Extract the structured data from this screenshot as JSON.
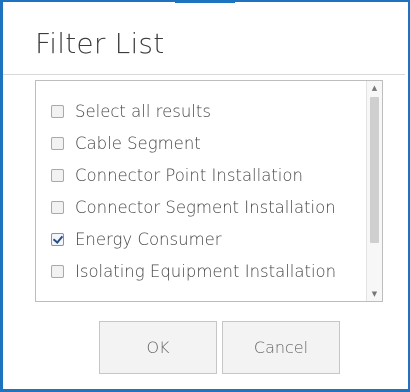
{
  "dialog": {
    "title": "Filter List",
    "items": [
      {
        "label": "Select all results",
        "checked": false
      },
      {
        "label": "Cable Segment",
        "checked": false
      },
      {
        "label": "Connector Point Installation",
        "checked": false
      },
      {
        "label": "Connector Segment Installation",
        "checked": false
      },
      {
        "label": "Energy Consumer",
        "checked": true
      },
      {
        "label": "Isolating Equipment Installation",
        "checked": false
      }
    ],
    "ok_label": "OK",
    "cancel_label": "Cancel"
  },
  "colors": {
    "accent": "#1e73be",
    "checkmark": "#2a4d86"
  }
}
